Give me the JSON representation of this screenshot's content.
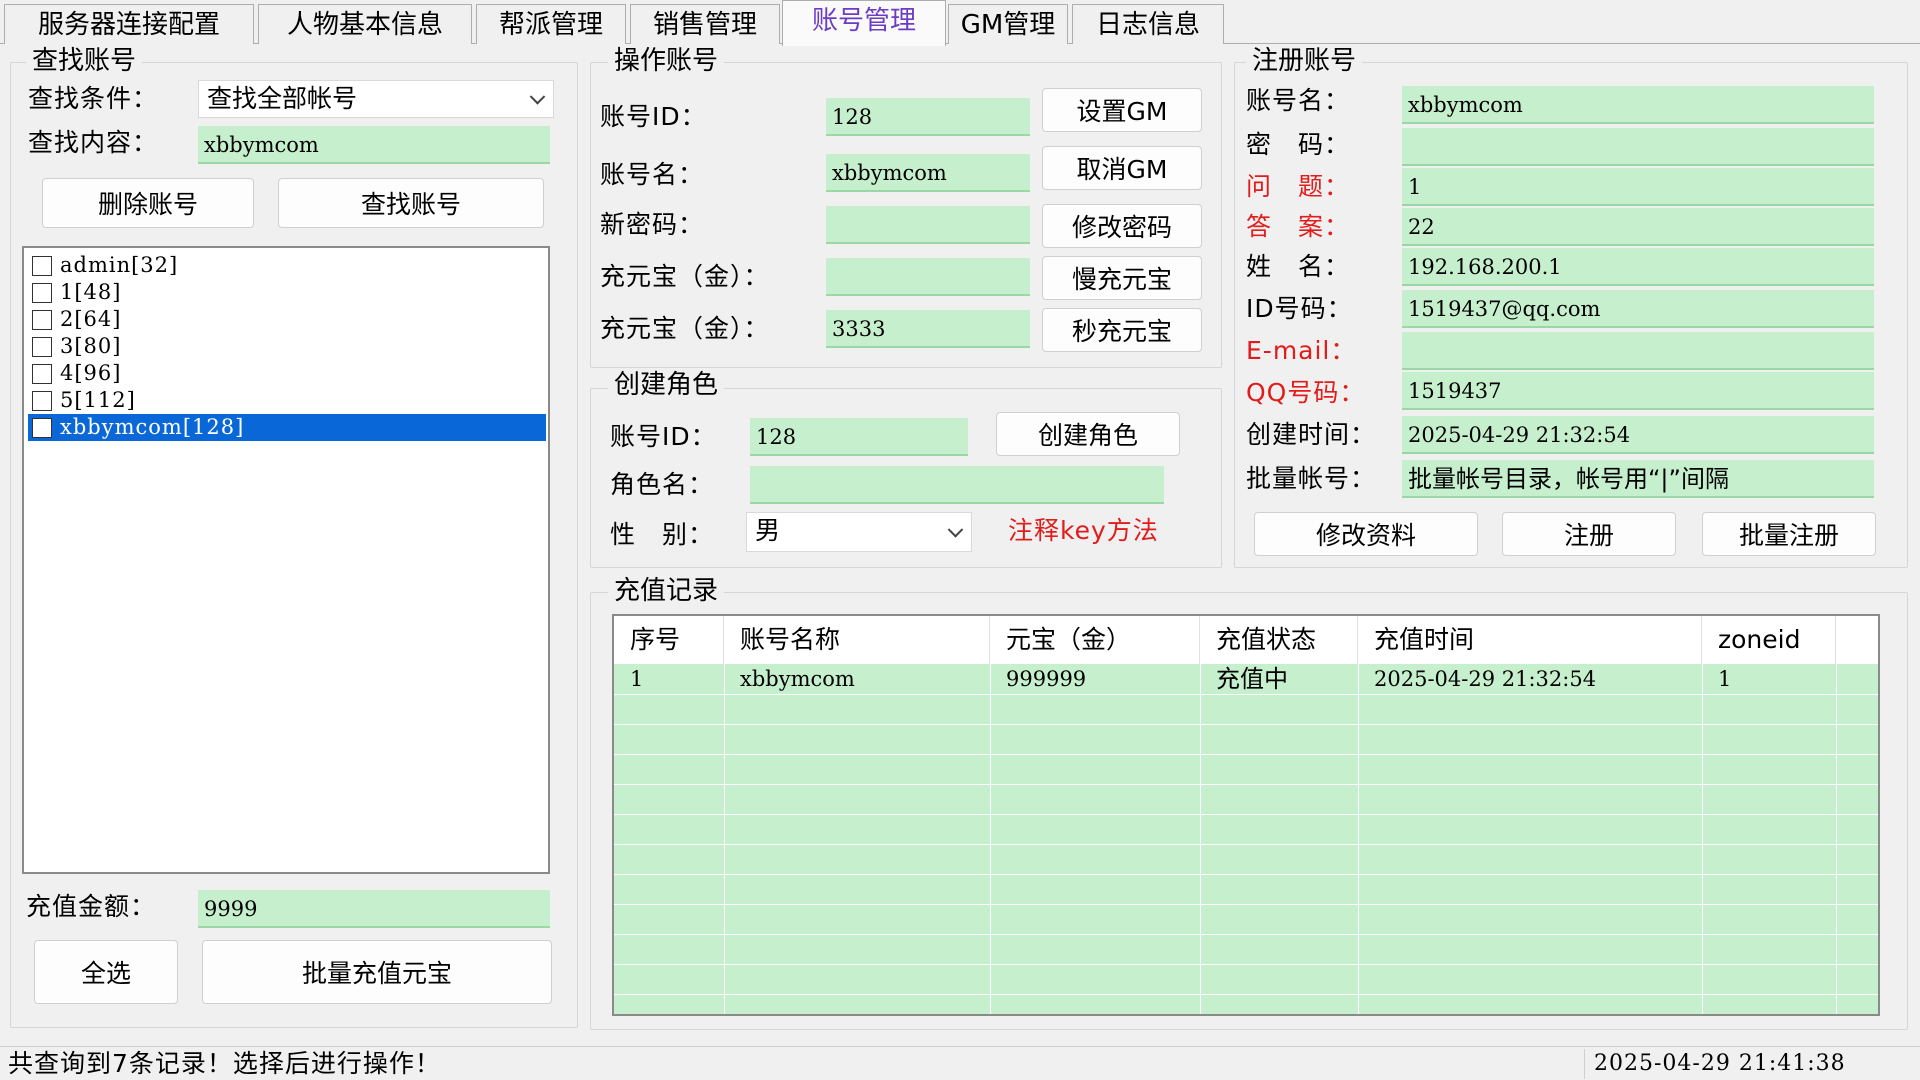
{
  "tabs": [
    "服务器连接配置",
    "人物基本信息",
    "帮派管理",
    "销售管理",
    "账号管理",
    "GM管理",
    "日志信息"
  ],
  "search": {
    "title": "查找账号",
    "cond_label": "查找条件：",
    "cond_value": "查找全部帐号",
    "content_label": "查找内容：",
    "content_value": "xbbymcom",
    "delete_btn": "删除账号",
    "find_btn": "查找账号",
    "list": [
      "admin[32]",
      "1[48]",
      "2[64]",
      "3[80]",
      "4[96]",
      "5[112]",
      "xbbymcom[128]"
    ],
    "amount_label": "充值金额：",
    "amount_value": "9999",
    "select_all_btn": "全选",
    "batch_btn": "批量充值元宝"
  },
  "operate": {
    "title": "操作账号",
    "id_label": "账号ID：",
    "id_value": "128",
    "name_label": "账号名：",
    "name_value": "xbbymcom",
    "newpwd_label": "新密码：",
    "newpwd_value": "",
    "charge1_label": "充元宝（金）：",
    "charge1_value": "",
    "charge2_label": "充元宝（金）：",
    "charge2_value": "3333",
    "set_gm_btn": "设置GM",
    "cancel_gm_btn": "取消GM",
    "change_pwd_btn": "修改密码",
    "slow_charge_btn": "慢充元宝",
    "fast_charge_btn": "秒充元宝"
  },
  "create": {
    "title": "创建角色",
    "id_label": "账号ID：",
    "id_value": "128",
    "role_label": "角色名：",
    "role_value": "",
    "gender_label": "性　别：",
    "gender_value": "男",
    "create_btn": "创建角色",
    "note": "注释key方法"
  },
  "register": {
    "title": "注册账号",
    "fields": [
      {
        "label": "账号名：",
        "value": "xbbymcom",
        "red": false
      },
      {
        "label": "密　码：",
        "value": "",
        "red": false
      },
      {
        "label": "问　题：",
        "value": "1",
        "red": true
      },
      {
        "label": "答　案：",
        "value": "22",
        "red": true
      },
      {
        "label": "姓　名：",
        "value": "192.168.200.1",
        "red": false
      },
      {
        "label": "ID号码：",
        "value": "1519437@qq.com",
        "red": false
      },
      {
        "label": "E-mail：",
        "value": "",
        "red": true
      },
      {
        "label": "QQ号码：",
        "value": "1519437",
        "red": true
      },
      {
        "label": "创建时间：",
        "value": "2025-04-29 21:32:54",
        "red": false
      },
      {
        "label": "批量帐号：",
        "value": "批量帐号目录，帐号用“|”间隔",
        "red": false
      }
    ],
    "modify_btn": "修改资料",
    "register_btn": "注册",
    "batch_register_btn": "批量注册"
  },
  "records": {
    "title": "充值记录",
    "headers": [
      "序号",
      "账号名称",
      "元宝（金）",
      "充值状态",
      "充值时间",
      "zoneid"
    ],
    "rows": [
      [
        "1",
        "xbbymcom",
        "999999",
        "充值中",
        "2025-04-29 21:32:54",
        "1"
      ]
    ]
  },
  "status": {
    "message": "共查询到7条记录！选择后进行操作！",
    "time": "2025-04-29 21:41:38"
  },
  "colors": {
    "input_green": "#c6efcd",
    "selection_blue": "#0a67d8",
    "label_red": "#e21b1b",
    "active_tab_purple": "#6b3cc4"
  }
}
